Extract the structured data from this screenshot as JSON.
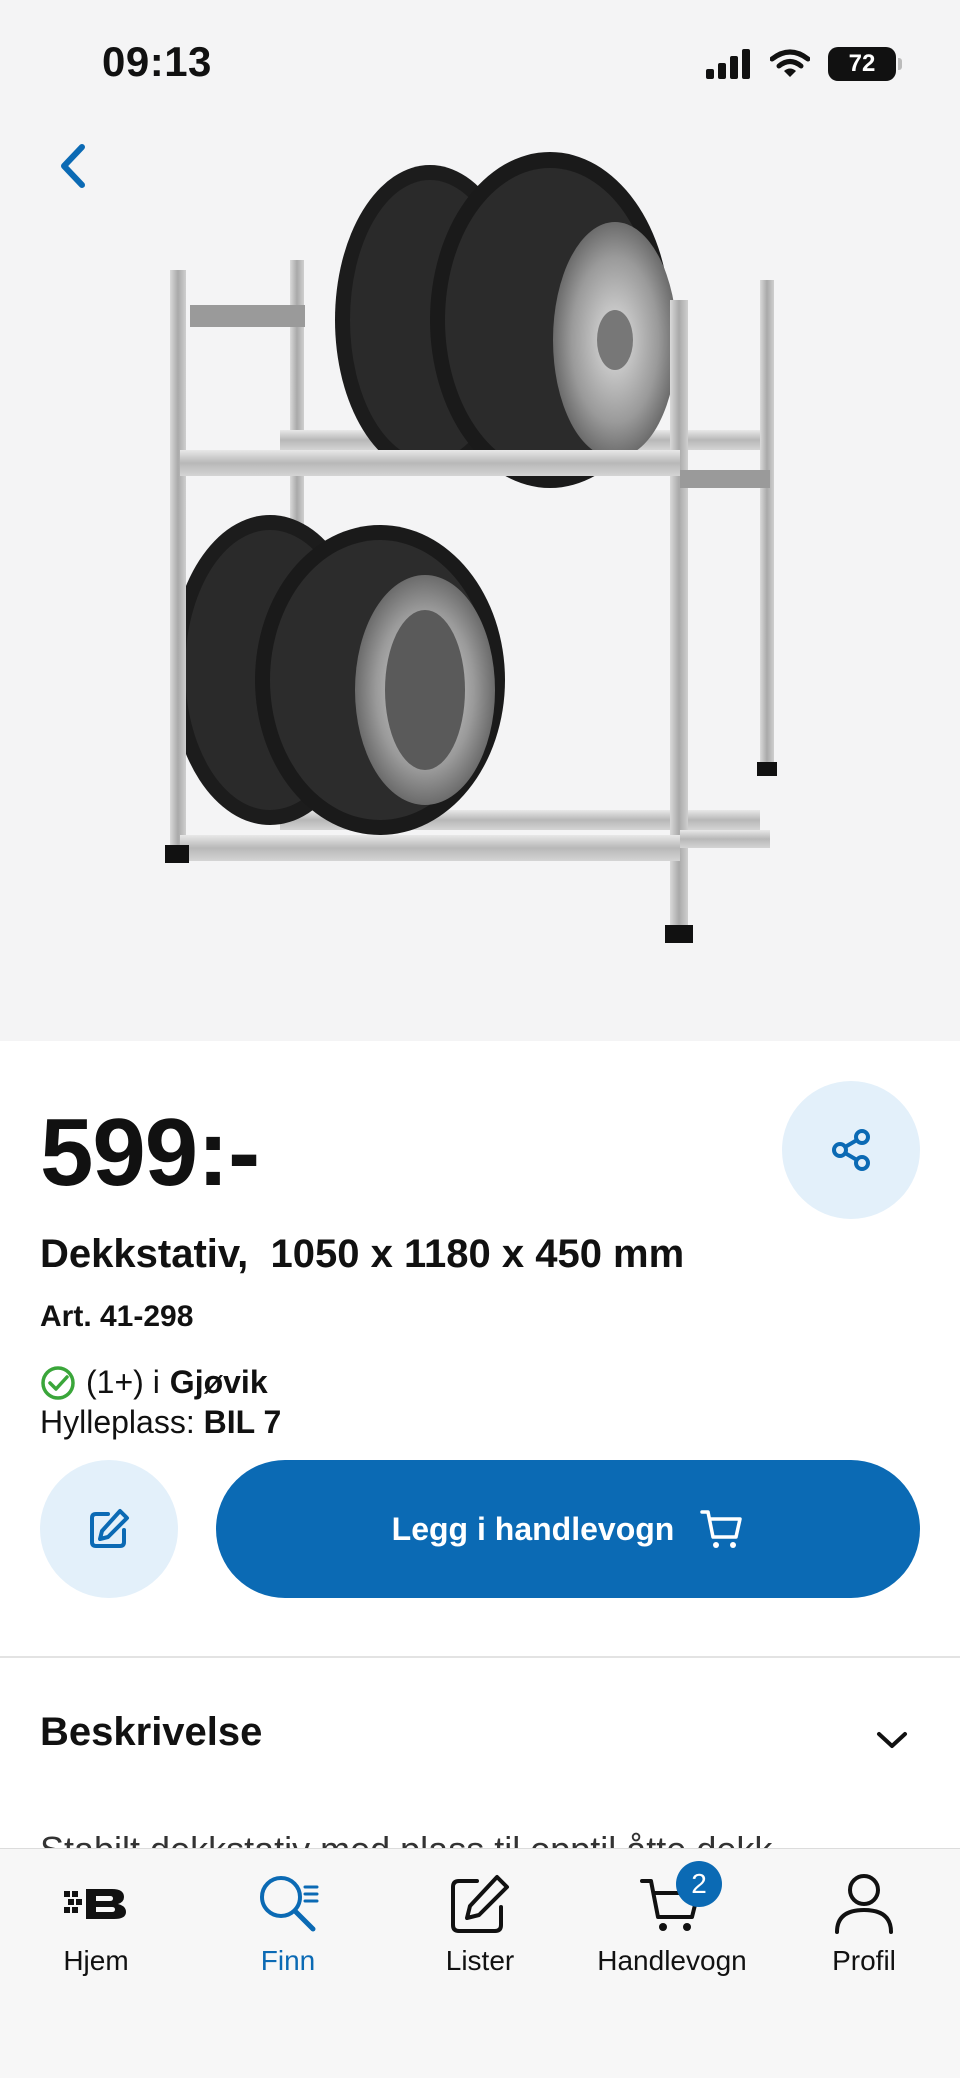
{
  "status_bar": {
    "time": "09:13",
    "battery": "72"
  },
  "product": {
    "price": "599:-",
    "title": "Dekkstativ,  1050 x 1180 x 450 mm",
    "article": "Art. 41-298",
    "stock_count": "(1+) i",
    "stock_store": "Gjøvik",
    "shelf_label": "Hylleplass:",
    "shelf_value": "BIL 7"
  },
  "actions": {
    "add_to_cart": "Legg i handlevogn"
  },
  "description": {
    "title": "Beskrivelse",
    "text": "Stabilt dekkstativ med plass til opptil åtte dekk"
  },
  "tabbar": {
    "items": [
      {
        "label": "Hjem"
      },
      {
        "label": "Finn"
      },
      {
        "label": "Lister"
      },
      {
        "label": "Handlevogn",
        "badge": "2"
      },
      {
        "label": "Profil"
      }
    ]
  },
  "colors": {
    "accent": "#0b6ab4",
    "accent_light": "#e3f0fa",
    "success": "#3aa63a"
  }
}
